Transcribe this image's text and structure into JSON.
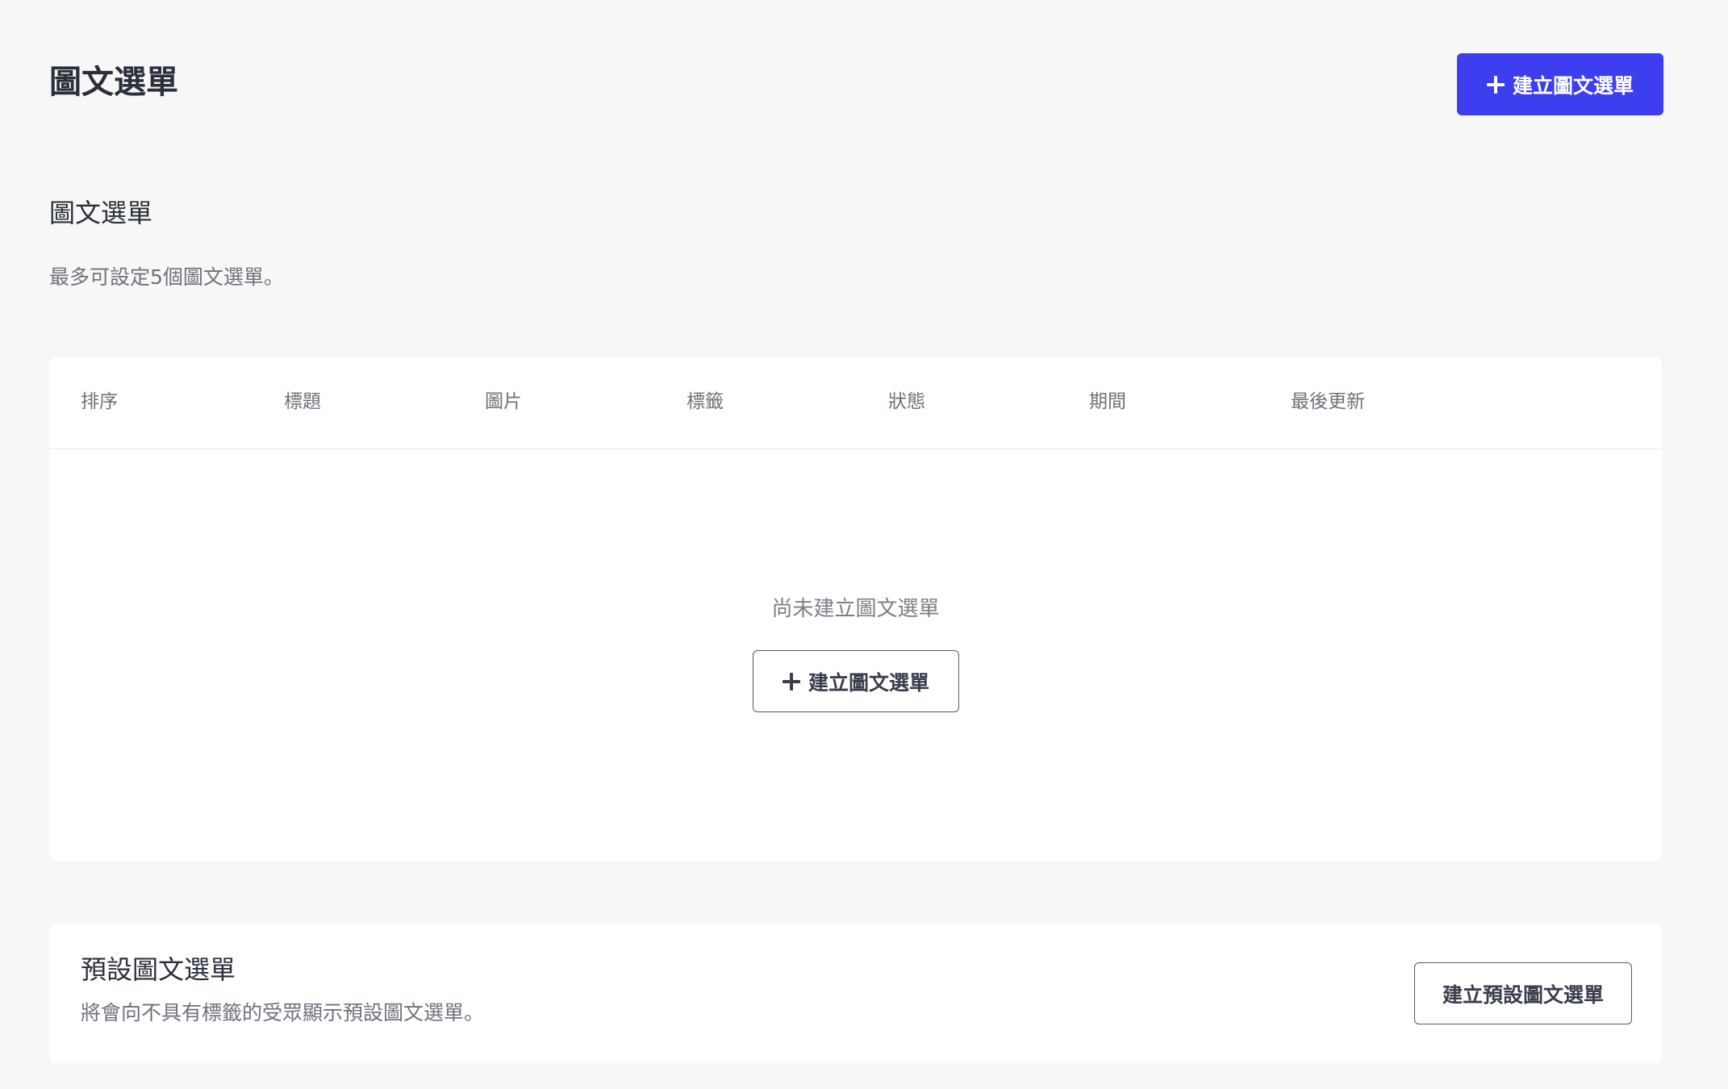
{
  "header": {
    "title": "圖文選單",
    "create_button_label": "建立圖文選單"
  },
  "section": {
    "title": "圖文選單",
    "description": "最多可設定5個圖文選單。"
  },
  "table": {
    "columns": [
      "排序",
      "標題",
      "圖片",
      "標籤",
      "狀態",
      "期間",
      "最後更新"
    ],
    "empty_text": "尚未建立圖文選單",
    "empty_create_label": "建立圖文選單"
  },
  "default_menu": {
    "title": "預設圖文選單",
    "description": "將會向不具有標籤的受眾顯示預設圖文選單。",
    "button_label": "建立預設圖文選單"
  },
  "colors": {
    "primary": "#3c3ef0",
    "background": "#f7f7f7"
  }
}
